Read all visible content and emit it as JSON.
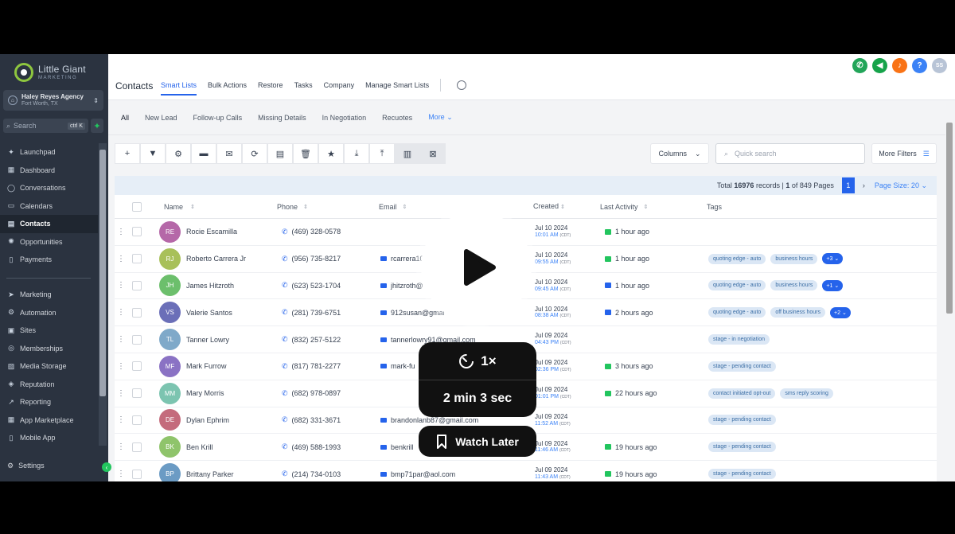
{
  "logo": {
    "line1": "Little Giant",
    "line2": "MARKETING"
  },
  "agency": {
    "name": "Haley Reyes Agency",
    "location": "Fort Worth, TX"
  },
  "sidebar": {
    "search_placeholder": "Search",
    "search_kbd": "ctrl K",
    "items": [
      {
        "label": "Launchpad",
        "icon": "rocket-icon",
        "glyph": "✦"
      },
      {
        "label": "Dashboard",
        "icon": "dashboard-icon",
        "glyph": "▦"
      },
      {
        "label": "Conversations",
        "icon": "chat-icon",
        "glyph": "◯"
      },
      {
        "label": "Calendars",
        "icon": "calendar-icon",
        "glyph": "▭"
      },
      {
        "label": "Contacts",
        "icon": "contacts-icon",
        "glyph": "▤"
      },
      {
        "label": "Opportunities",
        "icon": "opportunities-icon",
        "glyph": "✺"
      },
      {
        "label": "Payments",
        "icon": "payments-icon",
        "glyph": "▯"
      }
    ],
    "items2": [
      {
        "label": "Marketing",
        "icon": "send-icon",
        "glyph": "➤"
      },
      {
        "label": "Automation",
        "icon": "automation-icon",
        "glyph": "⚙"
      },
      {
        "label": "Sites",
        "icon": "sites-icon",
        "glyph": "▣"
      },
      {
        "label": "Memberships",
        "icon": "memberships-icon",
        "glyph": "◎"
      },
      {
        "label": "Media Storage",
        "icon": "media-icon",
        "glyph": "▨"
      },
      {
        "label": "Reputation",
        "icon": "reputation-icon",
        "glyph": "◈"
      },
      {
        "label": "Reporting",
        "icon": "reporting-icon",
        "glyph": "↗"
      },
      {
        "label": "App Marketplace",
        "icon": "marketplace-icon",
        "glyph": "▦"
      },
      {
        "label": "Mobile App",
        "icon": "mobile-icon",
        "glyph": "▯"
      }
    ],
    "settings": "Settings"
  },
  "header": {
    "title": "Contacts",
    "nav": [
      "Smart Lists",
      "Bulk Actions",
      "Restore",
      "Tasks",
      "Company",
      "Manage Smart Lists"
    ],
    "user_initials": "SS"
  },
  "subtabs": [
    "All",
    "New Lead",
    "Follow-up Calls",
    "Missing Details",
    "In Negotiation",
    "Recuotes"
  ],
  "subtabs_more": "More",
  "controls": {
    "columns": "Columns",
    "quick_search": "Quick search",
    "more_filters": "More Filters"
  },
  "pager": {
    "total_prefix": "Total",
    "total": "16976",
    "records_text": "records |",
    "page": "1",
    "of_text": "of 849 Pages",
    "current": "1",
    "page_size": "Page Size: 20"
  },
  "columns": [
    "Name",
    "Phone",
    "Email",
    "Created",
    "Last Activity",
    "Tags"
  ],
  "rows": [
    {
      "initials": "RE",
      "color": "#b568a8",
      "name": "Rocie Escamilla",
      "phone": "(469) 328-0578",
      "email": "",
      "date": "Jul 10 2024",
      "time": "10:01 AM",
      "tz": "(CDT)",
      "activity": "1 hour ago",
      "act_type": "msg",
      "tags": []
    },
    {
      "initials": "RJ",
      "color": "#a8c05a",
      "name": "Roberto Carrera Jr",
      "phone": "(956) 735-8217",
      "email": "rcarrera10",
      "date": "Jul 10 2024",
      "time": "09:55 AM",
      "tz": "(CDT)",
      "activity": "1 hour ago",
      "act_type": "msg",
      "tags": [
        "quoting edge - auto",
        "business hours"
      ],
      "more": "+3"
    },
    {
      "initials": "JH",
      "color": "#6cbf6c",
      "name": "James Hitzroth",
      "phone": "(623) 523-1704",
      "email": "jhitzroth@",
      "date": "Jul 10 2024",
      "time": "09:45 AM",
      "tz": "(CDT)",
      "activity": "1 hour ago",
      "act_type": "email",
      "tags": [
        "quoting edge - auto",
        "business hours"
      ],
      "more": "+1"
    },
    {
      "initials": "VS",
      "color": "#6b6fb8",
      "name": "Valerie Santos",
      "phone": "(281) 739-6751",
      "email": "912susan@gmai",
      "date": "Jul 10 2024",
      "time": "08:38 AM",
      "tz": "(CDT)",
      "activity": "2 hours ago",
      "act_type": "email",
      "tags": [
        "quoting edge - auto",
        "off business hours"
      ],
      "more": "+2"
    },
    {
      "initials": "TL",
      "color": "#7fa9c9",
      "name": "Tanner Lowry",
      "phone": "(832) 257-5122",
      "email": "tannerlowry91@gmail.com",
      "date": "Jul 09 2024",
      "time": "04:43 PM",
      "tz": "(CDT)",
      "activity": "",
      "act_type": "",
      "tags": [
        "stage - in negotiation"
      ]
    },
    {
      "initials": "MF",
      "color": "#8a72c4",
      "name": "Mark Furrow",
      "phone": "(817) 781-2277",
      "email": "mark-fu",
      "date": "Jul 09 2024",
      "time": "02:36 PM",
      "tz": "(CDT)",
      "activity": "3 hours ago",
      "act_type": "msg",
      "tags": [
        "stage - pending contact"
      ]
    },
    {
      "initials": "MM",
      "color": "#7cc4b0",
      "name": "Mary Morris",
      "phone": "(682) 978-0897",
      "email": "",
      "date": "Jul 09 2024",
      "time": "01:01 PM",
      "tz": "(CDT)",
      "activity": "22 hours ago",
      "act_type": "msg",
      "tags": [
        "contact initiated opt-out",
        "sms reply scoring"
      ]
    },
    {
      "initials": "DE",
      "color": "#c46b7c",
      "name": "Dylan Ephrim",
      "phone": "(682) 331-3671",
      "email": "brandonlanb87@gmail.com",
      "date": "Jul 09 2024",
      "time": "11:52 AM",
      "tz": "(CDT)",
      "activity": "",
      "act_type": "",
      "tags": [
        "stage - pending contact"
      ]
    },
    {
      "initials": "BK",
      "color": "#8fc46b",
      "name": "Ben Krill",
      "phone": "(469) 588-1993",
      "email": "benkrill",
      "date": "Jul 09 2024",
      "time": "11:46 AM",
      "tz": "(CDT)",
      "activity": "19 hours ago",
      "act_type": "msg",
      "tags": [
        "stage - pending contact"
      ]
    },
    {
      "initials": "BP",
      "color": "#6b9bc4",
      "name": "Brittany Parker",
      "phone": "(214) 734-0103",
      "email": "bmp71par@aol.com",
      "date": "Jul 09 2024",
      "time": "11:43 AM",
      "tz": "(CDT)",
      "activity": "19 hours ago",
      "act_type": "msg",
      "tags": [
        "stage - pending contact"
      ]
    }
  ],
  "overlay": {
    "speed": "1×",
    "duration": "2 min 3 sec",
    "watch_later": "Watch Later"
  }
}
